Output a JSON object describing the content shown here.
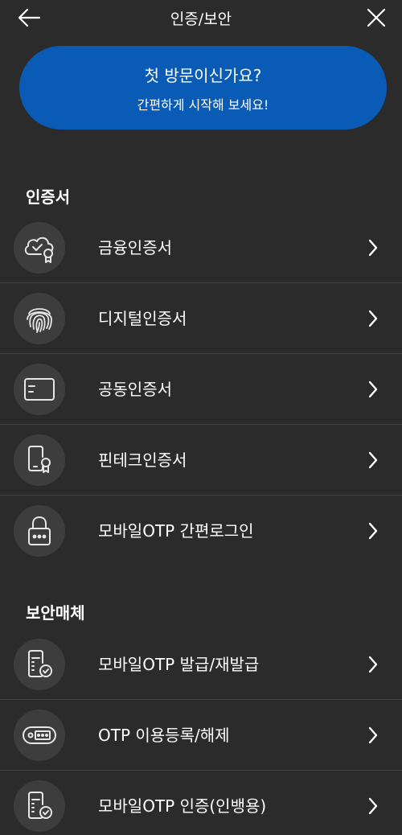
{
  "header": {
    "title": "인증/보안"
  },
  "promo": {
    "title": "첫 방문이신가요?",
    "subtitle": "간편하게 시작해 보세요!"
  },
  "sections": {
    "cert": {
      "title": "인증서",
      "items": [
        {
          "label": "금융인증서",
          "icon": "cloud-certificate-icon"
        },
        {
          "label": "디지털인증서",
          "icon": "fingerprint-icon"
        },
        {
          "label": "공동인증서",
          "icon": "card-icon"
        },
        {
          "label": "핀테크인증서",
          "icon": "phone-certificate-icon"
        },
        {
          "label": "모바일OTP 간편로그인",
          "icon": "lock-icon"
        }
      ]
    },
    "security": {
      "title": "보안매체",
      "items": [
        {
          "label": "모바일OTP 발급/재발급",
          "icon": "otp-device-check-icon"
        },
        {
          "label": "OTP 이용등록/해제",
          "icon": "otp-card-icon"
        },
        {
          "label": "모바일OTP 인증(인뱅용)",
          "icon": "otp-device-check-icon"
        }
      ]
    }
  }
}
